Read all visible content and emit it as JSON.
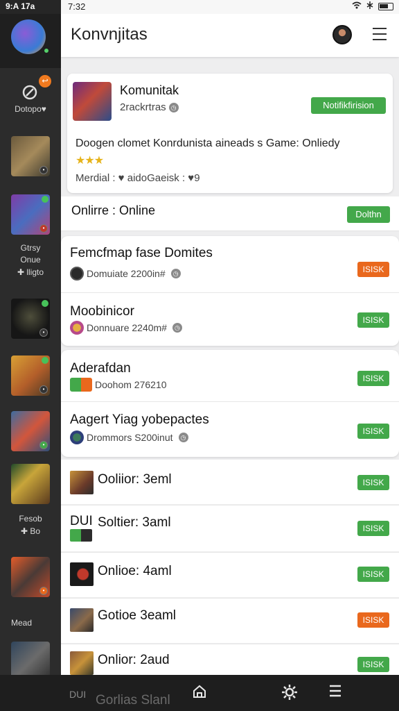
{
  "status_bar": {
    "left_time": "9:A 17a",
    "mid_time": "7:32",
    "icons": [
      "wifi-icon",
      "signal-icon",
      "battery-icon"
    ]
  },
  "sidebar": {
    "badge_count": "",
    "section_label": "Dotopo♥",
    "label_group_1": [
      "Gtrsy",
      "Onue",
      "lligto"
    ],
    "label_group_2": [
      "Fesob",
      "Bo"
    ],
    "label_group_3": "Mead",
    "games": [
      {
        "icon": "game-thumb-warrior"
      },
      {
        "icon": "game-thumb-mage"
      },
      {
        "icon": "game-thumb-dark"
      },
      {
        "icon": "game-thumb-hero"
      },
      {
        "icon": "game-thumb-battle"
      },
      {
        "icon": "game-thumb-fantasy"
      },
      {
        "icon": "game-thumb-knight"
      },
      {
        "icon": "game-thumb-soldier"
      },
      {
        "icon": "game-thumb-strategy"
      }
    ]
  },
  "header": {
    "title": "Konvnjitas"
  },
  "community": {
    "title": "Komunitak",
    "subtitle": "2rackrtras",
    "notify_button": "Notifikfirision",
    "description": "Doogen clomet Konrdunista aineads s Game: Onliedy",
    "stars": "★★★",
    "meta": "Merdial : ♥ aidoGaeisk : ♥9"
  },
  "online": {
    "label": "Onlirre : Online",
    "button": "Dolthn"
  },
  "friends_group_1": [
    {
      "name": "Femcfmap fase Domites",
      "sub": "Domuiate 2200in#",
      "button": "ISISK",
      "button_color": "#e9681d"
    },
    {
      "name": "Moobinicor",
      "sub": "Donnuare 2240m#",
      "button": "ISISK",
      "button_color": "#43a84a"
    }
  ],
  "friends_group_2": [
    {
      "name": "Aderafdan",
      "sub": "Doohom 276210",
      "button": "ISISK",
      "button_color": "#43a84a"
    },
    {
      "name": "Aagert Yiag yobepactes",
      "sub": "Drommors S200inut",
      "button": "ISISK",
      "button_color": "#43a84a"
    }
  ],
  "friends_list": [
    {
      "name": "Ooliior: 3eml",
      "prefix": "",
      "button": "ISISK",
      "button_color": "#43a84a"
    },
    {
      "name": "Soltier: 3aml",
      "prefix": "DUI",
      "button": "ISISK",
      "button_color": "#43a84a"
    },
    {
      "name": "Onlioe: 4aml",
      "prefix": "",
      "button": "ISISK",
      "button_color": "#43a84a"
    },
    {
      "name": "Gotioe 3eaml",
      "prefix": "",
      "button": "ISISK",
      "button_color": "#e9681d"
    },
    {
      "name": "Onlior: 2aud",
      "prefix": "",
      "button": "ISISK",
      "button_color": "#43a84a"
    }
  ],
  "bottom_partial": {
    "prefix": "DUI",
    "name": "Gorlias Slanl"
  },
  "bottom_nav": [
    "home-icon",
    "settings-icon",
    "menu-icon"
  ],
  "colors": {
    "green": "#43a84a",
    "orange": "#e9681d",
    "sidebar_bg": "#2c2c2c"
  }
}
